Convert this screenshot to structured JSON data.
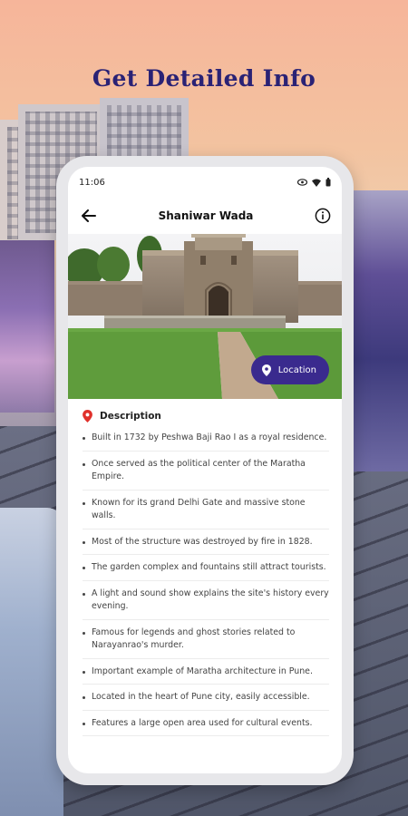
{
  "headline": "Get Detailed Info",
  "status_bar": {
    "time": "11:06"
  },
  "app_bar": {
    "title": "Shaniwar Wada",
    "back_icon": "arrow-left-icon",
    "info_icon": "info-icon"
  },
  "hero": {
    "location_button": "Location"
  },
  "description": {
    "heading": "Description",
    "items": [
      "Built in 1732 by Peshwa Baji Rao I as a royal residence.",
      "Once served as the political center of the Maratha Empire.",
      "Known for its grand Delhi Gate and massive stone walls.",
      "Most of the structure was destroyed by fire in 1828.",
      "The garden complex and fountains still attract tourists.",
      "A light and sound show explains the site's history every evening.",
      "Famous for legends and ghost stories related to Narayanrao's murder.",
      "Important example of Maratha architecture in Pune.",
      "Located in the heart of Pune city, easily accessible.",
      "Features a large open area used for cultural events."
    ]
  },
  "colors": {
    "accent": "#3a2a8e",
    "headline": "#2a2275",
    "pin": "#e0312b"
  }
}
